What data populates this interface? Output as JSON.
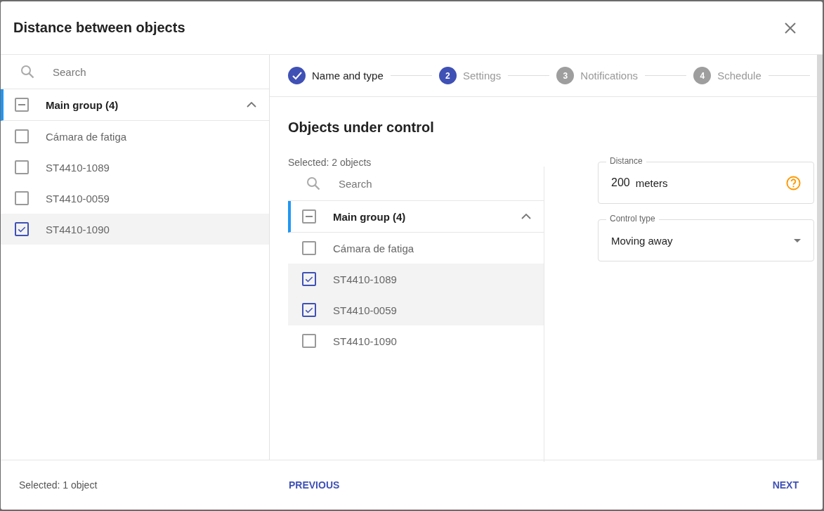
{
  "dialog": {
    "title": "Distance between objects"
  },
  "left_panel": {
    "search": {
      "placeholder": "Search"
    },
    "group": {
      "label": "Main group (4)",
      "expanded": true,
      "partial": true,
      "items": [
        {
          "label": "Cámara de fatiga",
          "checked": false
        },
        {
          "label": "ST4410-1089",
          "checked": false
        },
        {
          "label": "ST4410-0059",
          "checked": false
        },
        {
          "label": "ST4410-1090",
          "checked": true
        }
      ]
    }
  },
  "steps": [
    {
      "label": "Name and type",
      "completed": true,
      "selected": false
    },
    {
      "number": "2",
      "label": "Settings",
      "completed": false,
      "selected": true
    },
    {
      "number": "3",
      "label": "Notifications",
      "completed": false,
      "selected": false
    },
    {
      "number": "4",
      "label": "Schedule",
      "completed": false,
      "selected": false
    }
  ],
  "section_title": "Objects under control",
  "objects": {
    "selected_text": "Selected: 2 objects",
    "search": {
      "placeholder": "Search"
    },
    "group": {
      "label": "Main group (4)",
      "expanded": true,
      "partial": true,
      "items": [
        {
          "label": "Cámara de fatiga",
          "checked": false
        },
        {
          "label": "ST4410-1089",
          "checked": true
        },
        {
          "label": "ST4410-0059",
          "checked": true
        },
        {
          "label": "ST4410-1090",
          "checked": false
        }
      ]
    }
  },
  "distance": {
    "label": "Distance",
    "value": "200",
    "unit": "meters"
  },
  "control_type": {
    "label": "Control type",
    "value": "Moving away"
  },
  "footer": {
    "selected_text": "Selected: 1 object",
    "previous": "PREVIOUS",
    "next": "NEXT"
  }
}
